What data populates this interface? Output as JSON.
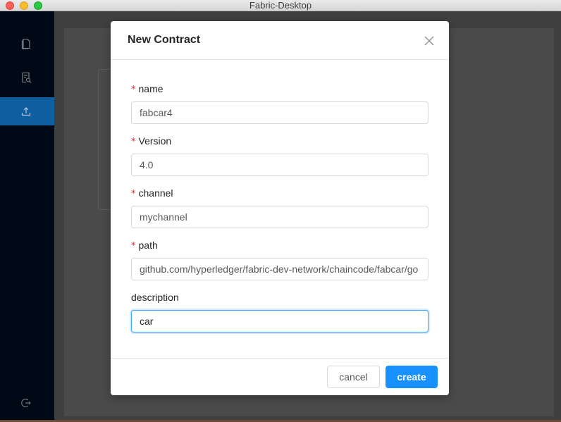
{
  "window": {
    "title": "Fabric-Desktop"
  },
  "sidebar": {
    "items": [
      {
        "icon": "document-icon",
        "active": false
      },
      {
        "icon": "search-document-icon",
        "active": false
      },
      {
        "icon": "upload-icon",
        "active": true
      }
    ],
    "footer_icon": "logout-icon"
  },
  "modal": {
    "title": "New Contract",
    "close_icon": "close-icon",
    "fields": {
      "name": {
        "label": "name",
        "required": true,
        "value": "fabcar4"
      },
      "version": {
        "label": "Version",
        "required": true,
        "value": "4.0"
      },
      "channel": {
        "label": "channel",
        "required": true,
        "value": "mychannel"
      },
      "path": {
        "label": "path",
        "required": true,
        "value": "github.com/hyperledger/fabric-dev-network/chaincode/fabcar/go"
      },
      "description": {
        "label": "description",
        "required": false,
        "value": "car"
      }
    },
    "required_mark": "*",
    "cancel_label": "cancel",
    "create_label": "create"
  },
  "colors": {
    "primary": "#1890ff",
    "sidebar_bg": "#000a17",
    "active_nav": "#0f5ea0",
    "required": "#f5222d"
  }
}
